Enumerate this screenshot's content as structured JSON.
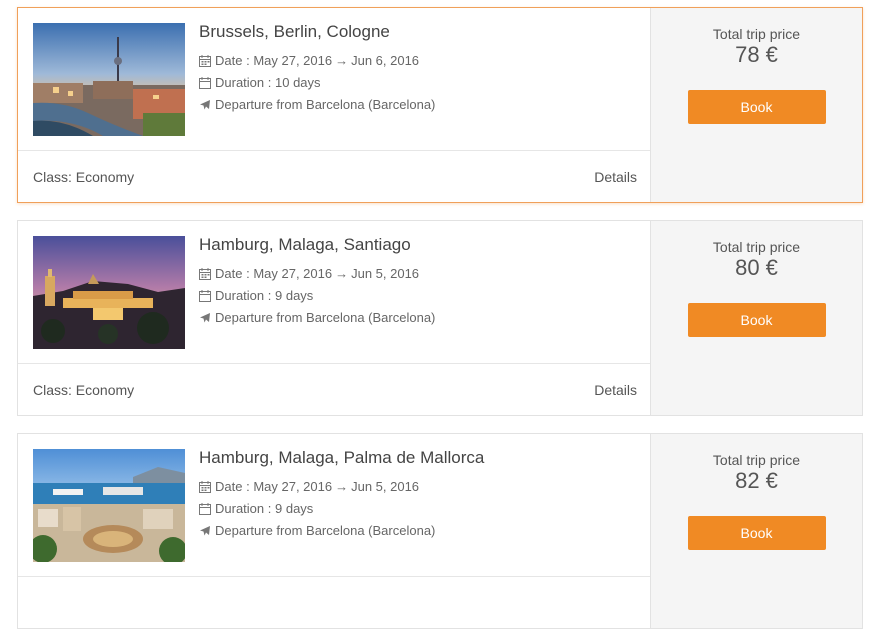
{
  "trips": [
    {
      "title": "Brussels, Berlin, Cologne",
      "date_label": "Date :",
      "date_from": "May 27, 2016",
      "date_arrow": "→",
      "date_to": "Jun 6, 2016",
      "duration_label": "Duration :",
      "duration": "10 days",
      "departure": "Departure from Barcelona (Barcelona)",
      "class": "Class: Economy",
      "details_label": "Details",
      "price_label": "Total trip price",
      "price": "78 €",
      "book_label": "Book",
      "image": "berlin-city-photo",
      "active": true
    },
    {
      "title": "Hamburg, Malaga, Santiago",
      "date_label": "Date :",
      "date_from": "May 27, 2016",
      "date_arrow": "→",
      "date_to": "Jun 5, 2016",
      "duration_label": "Duration :",
      "duration": "9 days",
      "departure": "Departure from Barcelona (Barcelona)",
      "class": "Class: Economy",
      "details_label": "Details",
      "price_label": "Total trip price",
      "price": "80 €",
      "book_label": "Book",
      "image": "malaga-night-photo",
      "active": false
    },
    {
      "title": "Hamburg, Malaga, Palma de Mallorca",
      "date_label": "Date :",
      "date_from": "May 27, 2016",
      "date_arrow": "→",
      "date_to": "Jun 5, 2016",
      "duration_label": "Duration :",
      "duration": "9 days",
      "departure": "Departure from Barcelona (Barcelona)",
      "class": "",
      "details_label": "",
      "price_label": "Total trip price",
      "price": "82 €",
      "book_label": "Book",
      "image": "malaga-harbor-photo",
      "active": false
    }
  ],
  "colors": {
    "accent": "#f08a24",
    "active_border": "#f0a05a",
    "panel_bg": "#f5f5f5"
  },
  "icons": [
    "calendar-icon",
    "calendar-icon",
    "plane-icon"
  ]
}
